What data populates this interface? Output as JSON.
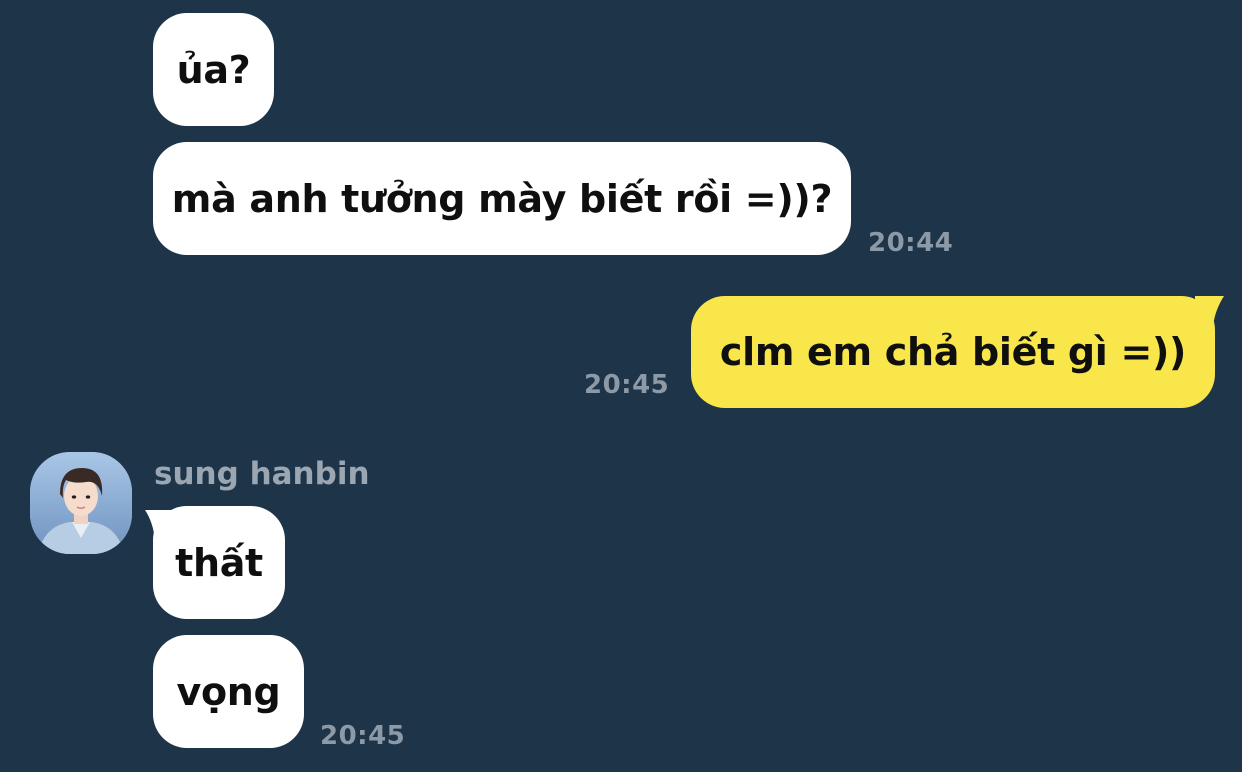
{
  "messages": [
    {
      "text": "ủa?",
      "direction": "incoming"
    },
    {
      "text": "mà anh tưởng mày biết rồi =))?",
      "direction": "incoming",
      "time": "20:44"
    },
    {
      "text": "clm em chả biết gì =))",
      "direction": "outgoing",
      "time": "20:45"
    },
    {
      "text": "thất",
      "direction": "incoming",
      "sender": "sung hanbin"
    },
    {
      "text": "vọng",
      "direction": "incoming",
      "time": "20:45"
    }
  ],
  "colors": {
    "background": "#1e3449",
    "incoming_bubble": "#ffffff",
    "outgoing_bubble": "#f9e64a",
    "timestamp": "#8c99a6",
    "sender_name": "#9aa6b2"
  },
  "icons": {
    "avatar": "profile-photo-avatar"
  }
}
